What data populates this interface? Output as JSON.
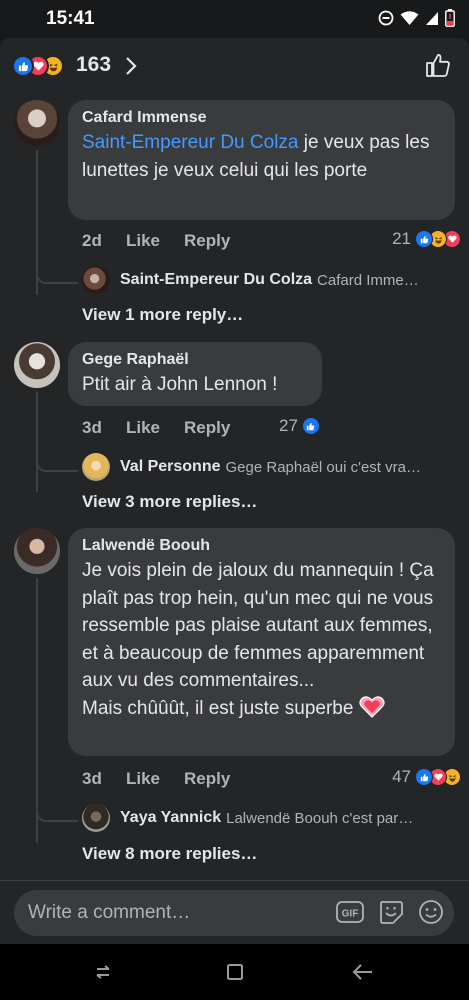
{
  "status": {
    "time": "15:41"
  },
  "header": {
    "reaction_count": "163"
  },
  "comments": [
    {
      "author": "Cafard Immense",
      "mention": "Saint-Empereur Du Colza",
      "text": " je veux pas les lunettes je veux celui qui les porte",
      "age": "2d",
      "like": "Like",
      "reply": "Reply",
      "reactions": "21",
      "replies": [
        {
          "name": "Saint-Empereur Du Colza",
          "snippet": "Cafard Imme…"
        }
      ],
      "more": "View 1 more reply…"
    },
    {
      "author": "Gege Raphaël",
      "text": "Ptit air à John Lennon !",
      "age": "3d",
      "like": "Like",
      "reply": "Reply",
      "reactions": "27",
      "replies": [
        {
          "name": "Val Personne",
          "snippet": "Gege Raphaël oui c'est vra…"
        }
      ],
      "more": "View 3 more replies…"
    },
    {
      "author": "Lalwendë Boouh",
      "text": "Je vois plein de jaloux du mannequin ! Ça plaît pas trop hein, qu'un mec qui ne vous ressemble pas plaise autant aux femmes, et à beaucoup de femmes apparemment aux vu des commentaires...\nMais chûûût, il est juste superbe",
      "age": "3d",
      "like": "Like",
      "reply": "Reply",
      "reactions": "47",
      "replies": [
        {
          "name": "Yaya Yannick",
          "snippet": "Lalwendë Boouh c'est par…"
        }
      ],
      "more": "View 8 more replies…"
    }
  ],
  "composer": {
    "placeholder": "Write a comment…",
    "gif_label": "GIF"
  },
  "colors": {
    "like": "#1877f2",
    "love": "#f33e58",
    "haha": "#f7b125",
    "mention": "#4599ff"
  }
}
